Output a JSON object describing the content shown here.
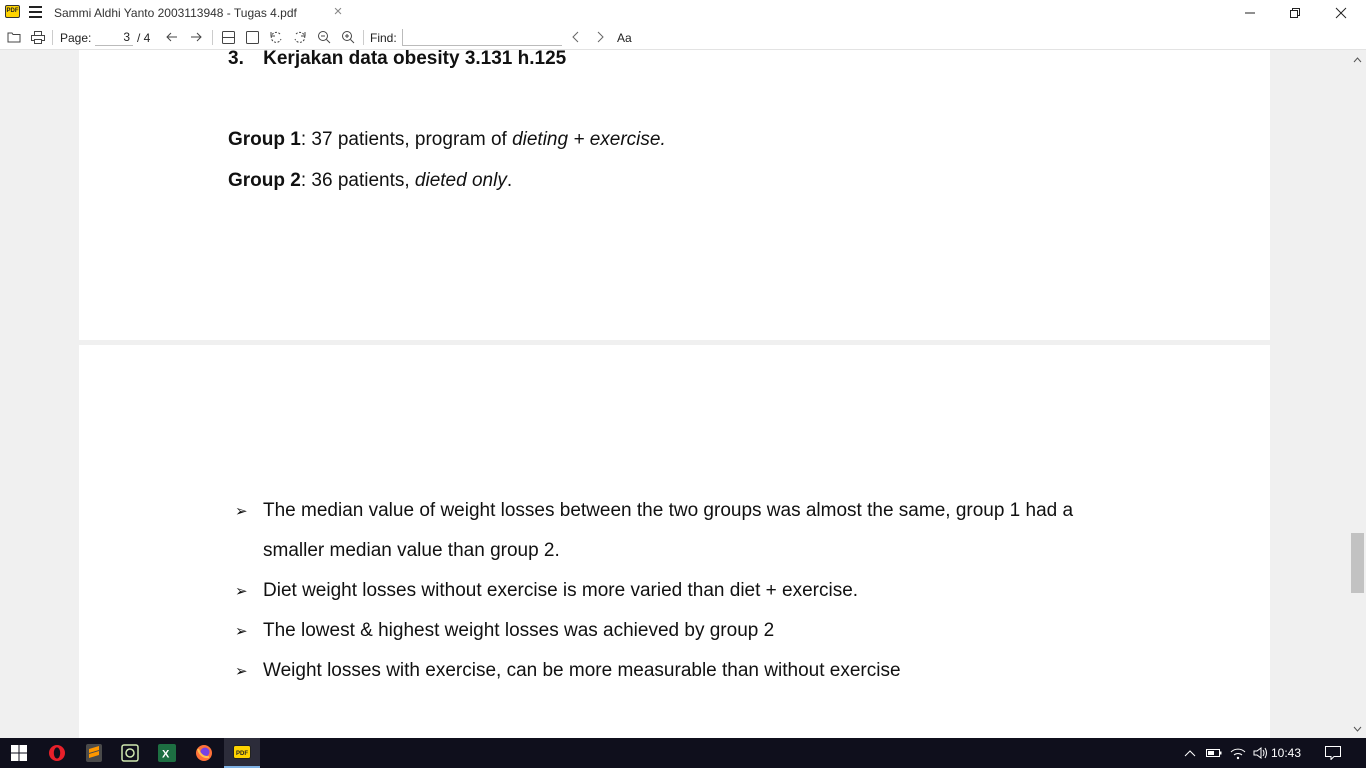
{
  "window": {
    "app_logo_text": "PDF",
    "title": "Sammi Aldhi Yanto 2003113948 - Tugas 4.pdf",
    "tab_close": "×"
  },
  "toolbar": {
    "page_label": "Page:",
    "current_page": "3",
    "total_pages": "/ 4",
    "find_label": "Find:",
    "find_value": "",
    "match_case_label": "Aa"
  },
  "document": {
    "page1": {
      "heading_number": "3.",
      "heading_text": "Kerjakan data obesity 3.131 h.125",
      "group1_label": "Group 1",
      "group1_text_plain": ": 37 patients, program of ",
      "group1_text_italic": "dieting + exercise.",
      "group2_label": "Group 2",
      "group2_text_plain": ": 36 patients, ",
      "group2_text_italic": "dieted only",
      "group2_text_end": "."
    },
    "page2": {
      "bullet_glyph": "➢",
      "bullets": [
        "The median value of weight losses between the two groups was almost the same, group 1 had a",
        "Diet weight losses without exercise is more varied than diet + exercise.",
        "The lowest & highest weight losses was achieved by group 2",
        "Weight losses with exercise, can be more measurable than without exercise"
      ],
      "bullet1_continuation": "smaller median value than group 2."
    }
  },
  "taskbar": {
    "apps": [
      "windows-start",
      "opera",
      "sublime-text",
      "utility-app",
      "excel",
      "firefox",
      "sumatra-pdf"
    ],
    "clock": "10:43"
  },
  "colors": {
    "taskbar_bg": "#0f0f1c",
    "pdf_logo": "#ffd400",
    "opera_red": "#e8202a",
    "excel_green": "#1d6f42",
    "firefox_orange": "#ff7139"
  }
}
